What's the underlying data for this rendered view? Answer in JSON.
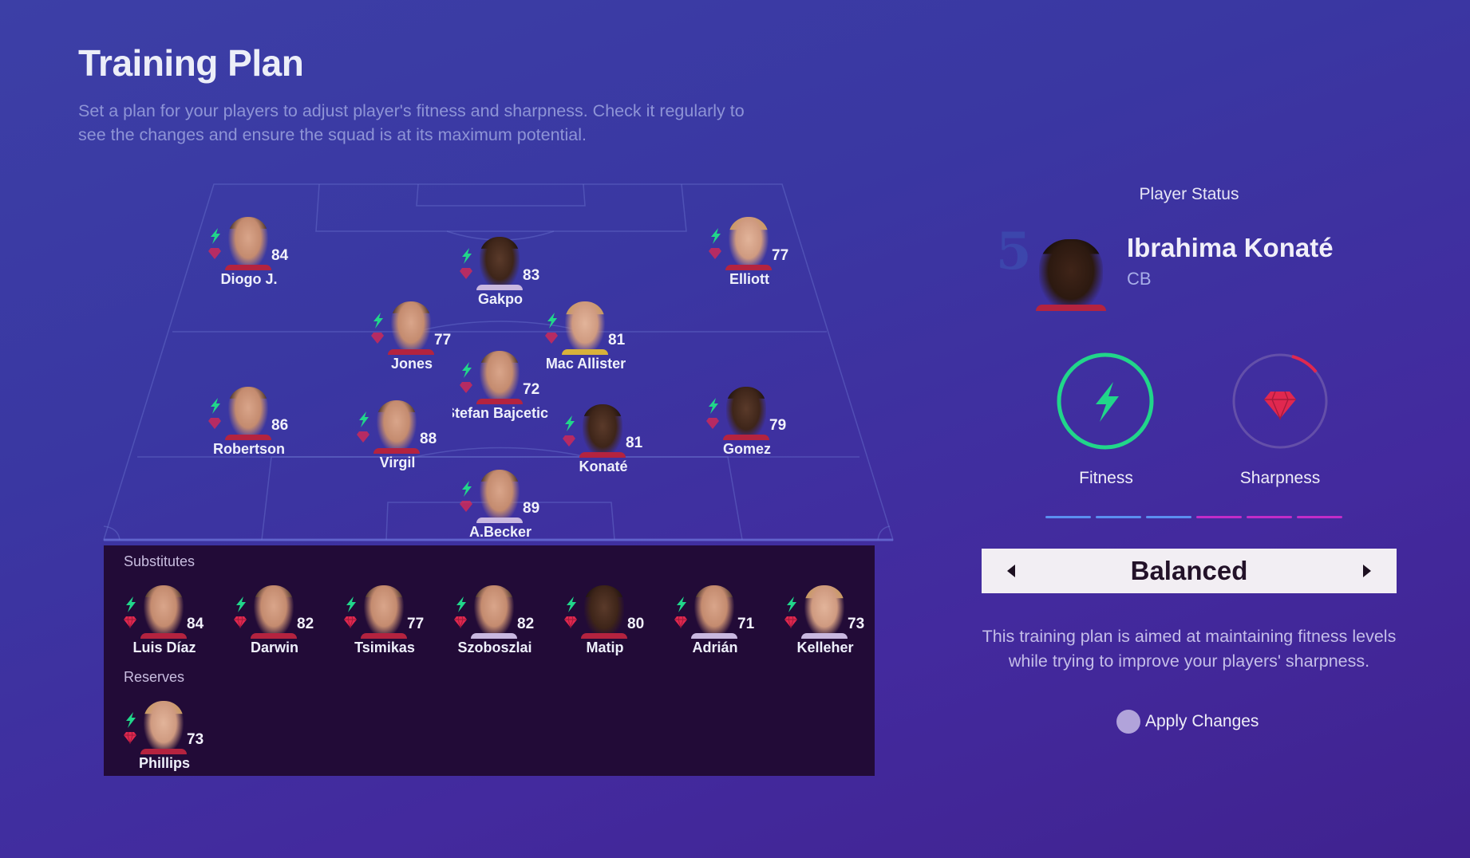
{
  "header": {
    "title": "Training Plan",
    "subtitle": "Set a plan for your players to adjust player's fitness and sharpness. Check it regularly to see the changes and ensure the squad is at its maximum potential."
  },
  "colors": {
    "fitness": "#21d68a",
    "sharpness": "#e0284f",
    "fitness_segment": "#5b8ff0",
    "sharpness_segment": "#c22cc8"
  },
  "lineup": [
    {
      "name": "Diogo J.",
      "rating": "84",
      "face": "light",
      "shirt": "red"
    },
    {
      "name": "Gakpo",
      "rating": "83",
      "face": "dark",
      "shirt": "gk"
    },
    {
      "name": "Elliott",
      "rating": "77",
      "face": "blond",
      "shirt": "red"
    },
    {
      "name": "Jones",
      "rating": "77",
      "face": "light",
      "shirt": "red"
    },
    {
      "name": "Mac Allister",
      "rating": "81",
      "face": "blond",
      "shirt": "ylw"
    },
    {
      "name": "Stefan Bajcetic",
      "rating": "72",
      "face": "light",
      "shirt": "red"
    },
    {
      "name": "Robertson",
      "rating": "86",
      "face": "light",
      "shirt": "red"
    },
    {
      "name": "Virgil",
      "rating": "88",
      "face": "light",
      "shirt": "red"
    },
    {
      "name": "Konaté",
      "rating": "81",
      "face": "dark",
      "shirt": "red"
    },
    {
      "name": "Gomez",
      "rating": "79",
      "face": "dark",
      "shirt": "red"
    },
    {
      "name": "A.Becker",
      "rating": "89",
      "face": "light",
      "shirt": "gk"
    }
  ],
  "substitutes": {
    "label": "Substitutes",
    "players": [
      {
        "name": "Luis Díaz",
        "rating": "84",
        "face": "light",
        "shirt": "red"
      },
      {
        "name": "Darwin",
        "rating": "82",
        "face": "light",
        "shirt": "red"
      },
      {
        "name": "Tsimikas",
        "rating": "77",
        "face": "light",
        "shirt": "red"
      },
      {
        "name": "Szoboszlai",
        "rating": "82",
        "face": "light",
        "shirt": "gk"
      },
      {
        "name": "Matip",
        "rating": "80",
        "face": "dark",
        "shirt": "red"
      },
      {
        "name": "Adrián",
        "rating": "71",
        "face": "light",
        "shirt": "gk"
      },
      {
        "name": "Kelleher",
        "rating": "73",
        "face": "blond",
        "shirt": "gk"
      }
    ]
  },
  "reserves": {
    "label": "Reserves",
    "players": [
      {
        "name": "Phillips",
        "rating": "73",
        "face": "blond",
        "shirt": "red"
      }
    ]
  },
  "player_status": {
    "title": "Player Status",
    "number": "5",
    "name": "Ibrahima Konaté",
    "position": "CB",
    "fitness_label": "Fitness",
    "sharpness_label": "Sharpness",
    "fitness_level": 1.0,
    "sharpness_level": 0.1,
    "fitness_segments": 3,
    "sharpness_segments": 3
  },
  "plan_selector": {
    "value": "Balanced",
    "description": "This training plan is aimed at maintaining fitness levels while trying to improve your players' sharpness.",
    "apply_label": "Apply Changes"
  },
  "icons": {
    "fitness": "lightning-bolt-icon",
    "sharpness": "diamond-gem-icon",
    "prev": "triangle-left-icon",
    "next": "triangle-right-icon"
  }
}
